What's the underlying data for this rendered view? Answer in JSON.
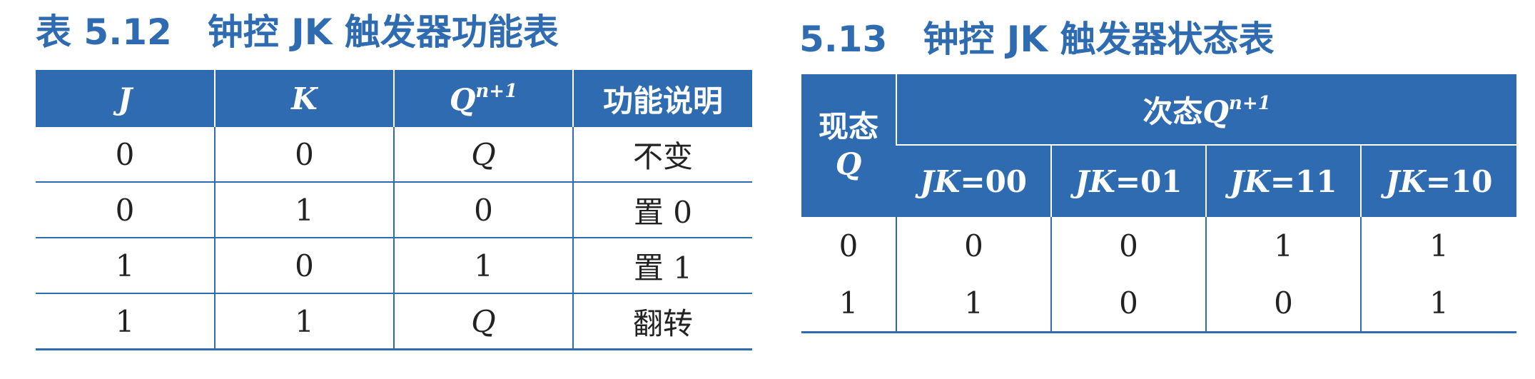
{
  "left": {
    "caption": "表 5.12　钟控 JK 触发器功能表",
    "headers": {
      "j": "J",
      "k": "K",
      "q_base": "Q",
      "q_sup": "n+1",
      "desc": "功能说明"
    },
    "rows": [
      {
        "j": "0",
        "k": "0",
        "q": "Q",
        "q_italic": true,
        "desc": "不变"
      },
      {
        "j": "0",
        "k": "1",
        "q": "0",
        "q_italic": false,
        "desc": "置 0"
      },
      {
        "j": "1",
        "k": "0",
        "q": "1",
        "q_italic": false,
        "desc": "置 1"
      },
      {
        "j": "1",
        "k": "1",
        "q": "Q",
        "q_italic": true,
        "desc": "翻转"
      }
    ]
  },
  "right": {
    "caption": "5.13　钟控 JK 触发器状态表",
    "present_line1": "现态",
    "present_line2": "Q",
    "next_label": "次态",
    "next_q": "Q",
    "next_sup": "n+1",
    "sub_headers": [
      {
        "jk": "JK",
        "val": "=00"
      },
      {
        "jk": "JK",
        "val": "=01"
      },
      {
        "jk": "JK",
        "val": "=11"
      },
      {
        "jk": "JK",
        "val": "=10"
      }
    ],
    "rows": [
      [
        "0",
        "0",
        "0",
        "1",
        "1"
      ],
      [
        "1",
        "1",
        "0",
        "0",
        "1"
      ]
    ]
  },
  "colors": {
    "accent": "#2e6bb1",
    "header_text": "#ffffff",
    "body_text": "#222222"
  }
}
